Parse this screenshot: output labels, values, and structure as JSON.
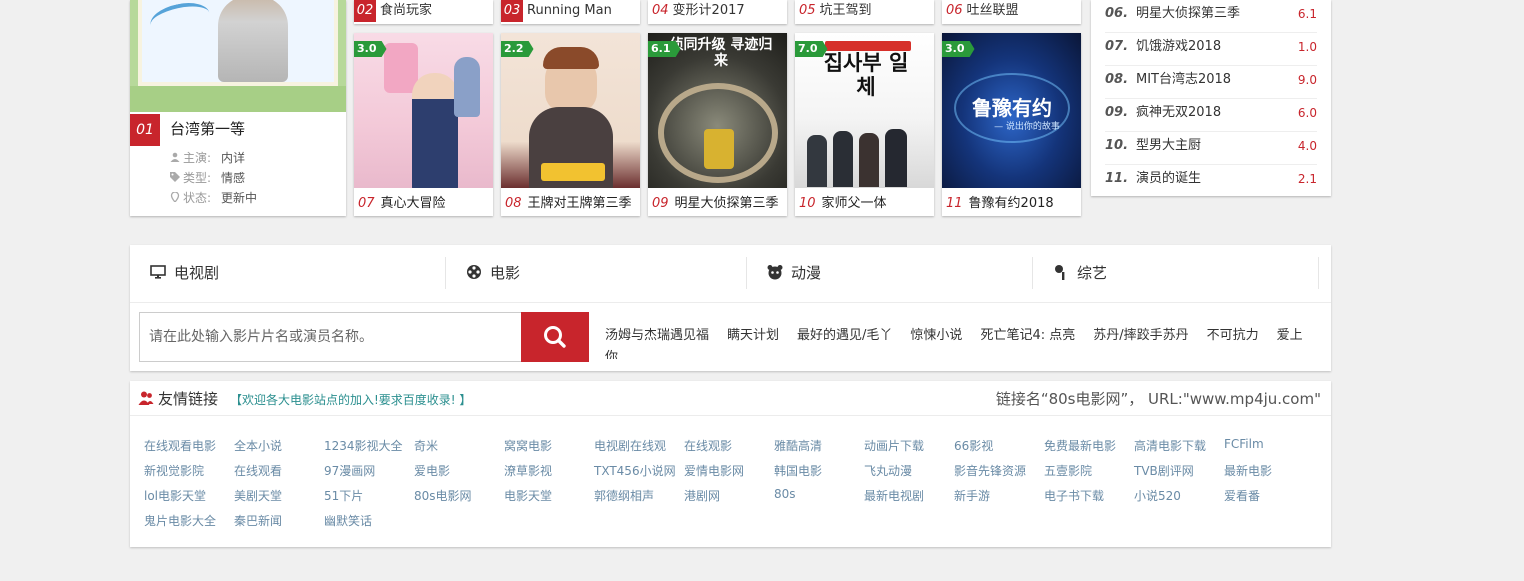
{
  "featured": {
    "rank": "01",
    "title": "台湾第一等",
    "meta": [
      {
        "key": "主演:",
        "value": "内详"
      },
      {
        "key": "类型:",
        "value": "情感"
      },
      {
        "key": "状态:",
        "value": "更新中"
      }
    ]
  },
  "top_strip": [
    {
      "num": "02",
      "title": "食尚玩家",
      "style": "fill"
    },
    {
      "num": "03",
      "title": "Running Man",
      "style": "fill"
    },
    {
      "num": "04",
      "title": "变形计2017",
      "style": "plain"
    },
    {
      "num": "05",
      "title": "坑王驾到",
      "style": "plain"
    },
    {
      "num": "06",
      "title": "吐丝联盟",
      "style": "plain"
    }
  ],
  "cards": [
    {
      "score": "3.0",
      "num": "07",
      "title": "真心大冒险"
    },
    {
      "score": "2.2",
      "num": "08",
      "title": "王牌对王牌第三季"
    },
    {
      "score": "6.1",
      "num": "09",
      "title": "明星大侦探第三季"
    },
    {
      "score": "7.0",
      "num": "10",
      "title": "家师父一体"
    },
    {
      "score": "3.0",
      "num": "11",
      "title": "鲁豫有约2018"
    }
  ],
  "card_overlays": {
    "c3_top": "侦同升级 寻迹归来",
    "c4_korean": "집사부 일체",
    "c5_logo": "鲁豫有约",
    "c5_sub": "— 说出你的故事"
  },
  "ranklist": [
    {
      "num": "06.",
      "title": "明星大侦探第三季",
      "score": "6.1"
    },
    {
      "num": "07.",
      "title": "饥饿游戏2018",
      "score": "1.0"
    },
    {
      "num": "08.",
      "title": "MIT台湾志2018",
      "score": "9.0"
    },
    {
      "num": "09.",
      "title": "疯神无双2018",
      "score": "6.0"
    },
    {
      "num": "10.",
      "title": "型男大主厨",
      "score": "4.0"
    },
    {
      "num": "11.",
      "title": "演员的诞生",
      "score": "2.1"
    }
  ],
  "nav": [
    {
      "label": "电视剧",
      "icon": "monitor-icon"
    },
    {
      "label": "电影",
      "icon": "film-reel-icon"
    },
    {
      "label": "动漫",
      "icon": "panda-icon"
    },
    {
      "label": "综艺",
      "icon": "microphone-icon"
    }
  ],
  "search": {
    "placeholder": "请在此处输入影片片名或演员名称。",
    "button_icon": "search-icon"
  },
  "hot_keywords": [
    "汤姆与杰瑞遇见福",
    "瞒天计划",
    "最好的遇见/毛丫",
    "惊悚小说",
    "死亡笔记4: 点亮",
    "苏丹/摔跤手苏丹",
    "不可抗力",
    "爱上你"
  ],
  "friends": {
    "title": "友情链接",
    "subtitle": "【欢迎各大电影站点的加入!要求百度收录! 】",
    "link_note": "链接名“80s电影网”， URL:\"www.mp4ju.com\"",
    "links": [
      [
        "在线观看电影",
        "全本小说",
        "1234影视大全",
        "奇米",
        "窝窝电影",
        "电视剧在线观",
        "在线观影",
        "雅酷高清",
        "动画片下载",
        "66影视",
        "免费最新电影",
        "高清电影下载",
        "FCFilm"
      ],
      [
        "新视觉影院",
        "在线观看",
        "97漫画网",
        "爱电影",
        "潦草影视",
        "TXT456小说网",
        "爱情电影网",
        "韩国电影",
        "飞丸动漫",
        "影音先锋资源",
        "五壹影院",
        "TVB剧评网",
        "最新电影"
      ],
      [
        "lol电影天堂",
        "美剧天堂",
        "51下片",
        "80s电影网",
        "电影天堂",
        "郭德纲相声",
        "港剧网",
        "80s",
        "最新电视剧",
        "新手游",
        "电子书下载",
        "小说520",
        "爱看番"
      ],
      [
        "鬼片电影大全",
        "秦巴新闻",
        "幽默笑话"
      ]
    ]
  },
  "colors": {
    "accent": "#c8252c",
    "score_green": "#2a9a3a",
    "link": "#6a8ba6",
    "subtitle_teal": "#2b8f8f"
  }
}
